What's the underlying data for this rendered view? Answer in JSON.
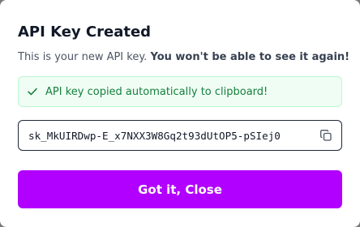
{
  "dialog": {
    "title": "API Key Created",
    "description_prefix": "This is your new API key.",
    "description_bold": "You won't be able to see it again!",
    "success_message": "API key copied automatically to clipboard!",
    "api_key_value": "sk_MkUIRDwp-E_x7NXX3W8Gq2t93dUtOP5-pSIej0",
    "close_label": "Got it, Close"
  },
  "icons": {
    "success": "check-icon",
    "copy": "copy-icon"
  },
  "colors": {
    "accent": "#b100ff",
    "success_bg": "#f0fdf4",
    "success_border": "#bbf7d0",
    "success_text": "#15803d"
  }
}
